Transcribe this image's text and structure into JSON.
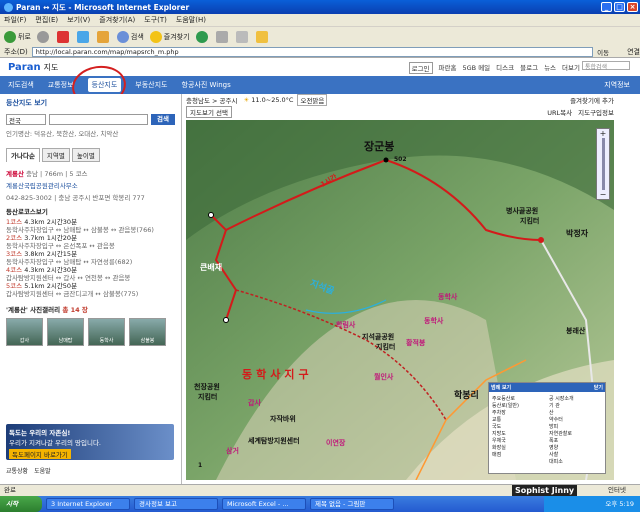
{
  "window": {
    "title": "Paran ↔ 지도 - Microsoft Internet Explorer"
  },
  "menu": [
    "파일(F)",
    "편집(E)",
    "보기(V)",
    "즐겨찾기(A)",
    "도구(T)",
    "도움말(H)"
  ],
  "toolbar": {
    "back": "뒤로",
    "search": "검색",
    "favorites": "즐겨찾기"
  },
  "address": {
    "label": "주소(D)",
    "url": "http://local.paran.com/map/mapsrch_m.php",
    "go": "이동",
    "links": "연결"
  },
  "header": {
    "logo": "Paran",
    "logo_sub": "지도",
    "links": [
      "로그인",
      "파란홈",
      "5GB 메일",
      "디스크",
      "블로그",
      "뉴스",
      "더보기"
    ],
    "search_placeholder": "통합검색"
  },
  "nav": {
    "items": [
      "지도검색",
      "교통정보",
      "등산지도",
      "부동산지도",
      "항공사진 Wings"
    ],
    "right": "지역정보"
  },
  "left": {
    "title": "등산지도 보기",
    "region": "전국",
    "search_btn": "검색",
    "popular": "인기명산: 덕유산, 북한산, 오대산, 치악산",
    "tabs": [
      "가나다순",
      "지역별",
      "높이별"
    ],
    "result_head": "계룡산",
    "result_sub": "충남 | 766m | 5 코스",
    "result_desc": "계룡산국립공원관리사무소",
    "result_phone": "042-825-3002 | 충남 공주시 반포면 학봉리 777",
    "section": "등산로코스보기",
    "courses": [
      {
        "n": "1코스",
        "len": "4.3km",
        "time": "2시간30분",
        "route": "동학사주차장입구 ↔ 남매탑 ↔ 삼불봉 ↔ 관음봉(766)"
      },
      {
        "n": "2코스",
        "len": "3.7km",
        "time": "1시간20분",
        "route": "동학사주차장입구 ↔ 은선폭포 ↔ 관음봉"
      },
      {
        "n": "3코스",
        "len": "3.8km",
        "time": "2시간15분",
        "route": "동학사주차장입구 ↔ 남매탑 ↔ 자연성릉(682)"
      },
      {
        "n": "4코스",
        "len": "4.3km",
        "time": "2시간30분",
        "route": "갑사탐방지원센터 ↔ 갑사 ↔ 연천봉 ↔ 관음봉"
      },
      {
        "n": "5코스",
        "len": "5.1km",
        "time": "2시간50분",
        "route": "갑사탐방지원센터 ↔ 금잔디고개 ↔ 삼불봉(775)"
      }
    ],
    "gallery_title": "'계룡산' 사진갤러리",
    "gallery_count": "총 14 장",
    "thumbs": [
      "갑사",
      "남매탑",
      "동학사",
      "삼불봉"
    ],
    "banner_l1": "독도는 우리의 자존심!",
    "banner_l2": "우리가 지켜나갈 우리의 땅입니다.",
    "banner_btn": "독도페이지 바로가기",
    "bottom_links": [
      "교통상황",
      "도움말"
    ]
  },
  "maptop": {
    "area": "충청남도 > 공주시",
    "weather": "11.0~25.0°C",
    "weather_sub": "오전맑음",
    "print": "즐겨찾기에 추가",
    "layer": "지도보기 선택",
    "url": "URL복사",
    "guide": "지도구입정보"
  },
  "map": {
    "labels": [
      "장군봉",
      "502",
      "1시간",
      "병사골공원",
      "지킴터",
      "박정자",
      "큰배재",
      "지석골",
      "학림사",
      "동학사",
      "지석골공원",
      "지킴터",
      "천장공원",
      "지킴터",
      "동학사지구",
      "월인사",
      "동학사",
      "황적봉",
      "갑사",
      "봉래산",
      "학봉리",
      "자작바위",
      "세계탐방지원센터",
      "이연장",
      "삼거",
      "1"
    ]
  },
  "legend": {
    "title": "범례 보기",
    "close": "닫기",
    "col1": [
      "주요등산로",
      "등산로(일반)",
      "주차장",
      "교통",
      "국도",
      "지방도",
      "우체국",
      "화장실",
      "매점"
    ],
    "col2": [
      "공 시장소개",
      "기 관",
      "산",
      "약수터",
      "방피",
      "자연관찰로",
      "폭포",
      "영양",
      "사찰",
      "대피소"
    ]
  },
  "status": {
    "text": "완료",
    "zone": "인터넷"
  },
  "taskbar": {
    "start": "시작",
    "items": [
      "3 Internet Explorer",
      "경사정보 보고",
      "Microsoft Excel - ...",
      "제목 없음 - 그림판"
    ],
    "clock": "오후 5:19"
  },
  "watermark": "Sophist Jinny"
}
